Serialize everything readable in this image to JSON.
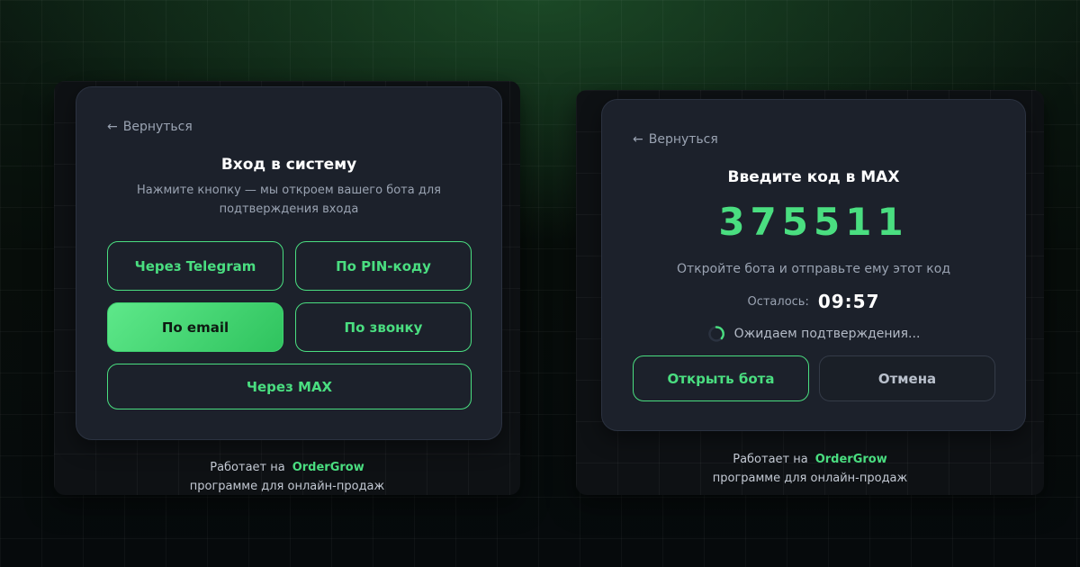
{
  "login": {
    "back_label": "Вернуться",
    "title": "Вход в систему",
    "subtitle_line1": "Нажмите кнопку — мы откроем вашего бота для",
    "subtitle_line2": "подтверждения входа",
    "buttons": {
      "telegram": "Через Telegram",
      "pin": "По PIN-коду",
      "email": "По email",
      "call": "По звонку",
      "max": "Через MAX"
    },
    "active_method": "email"
  },
  "verify": {
    "back_label": "Вернуться",
    "title": "Введите код в MAX",
    "code": "375511",
    "instruction": "Откройте бота и отправьте ему этот код",
    "remaining_label": "Осталось:",
    "timer": "09:57",
    "waiting_text": "Ожидаем подтверждения...",
    "open_bot_button": "Открыть бота",
    "cancel_button": "Отмена"
  },
  "footer": {
    "powered_prefix": "Работает на",
    "brand": "OrderGrow",
    "tagline": "программе для онлайн-продаж"
  },
  "colors": {
    "accent": "#4ade80",
    "card_bg": "#1c212b",
    "text_muted": "#9aa3b2"
  },
  "icons": {
    "back": "arrow-left-icon",
    "waiting": "spinner-icon"
  }
}
